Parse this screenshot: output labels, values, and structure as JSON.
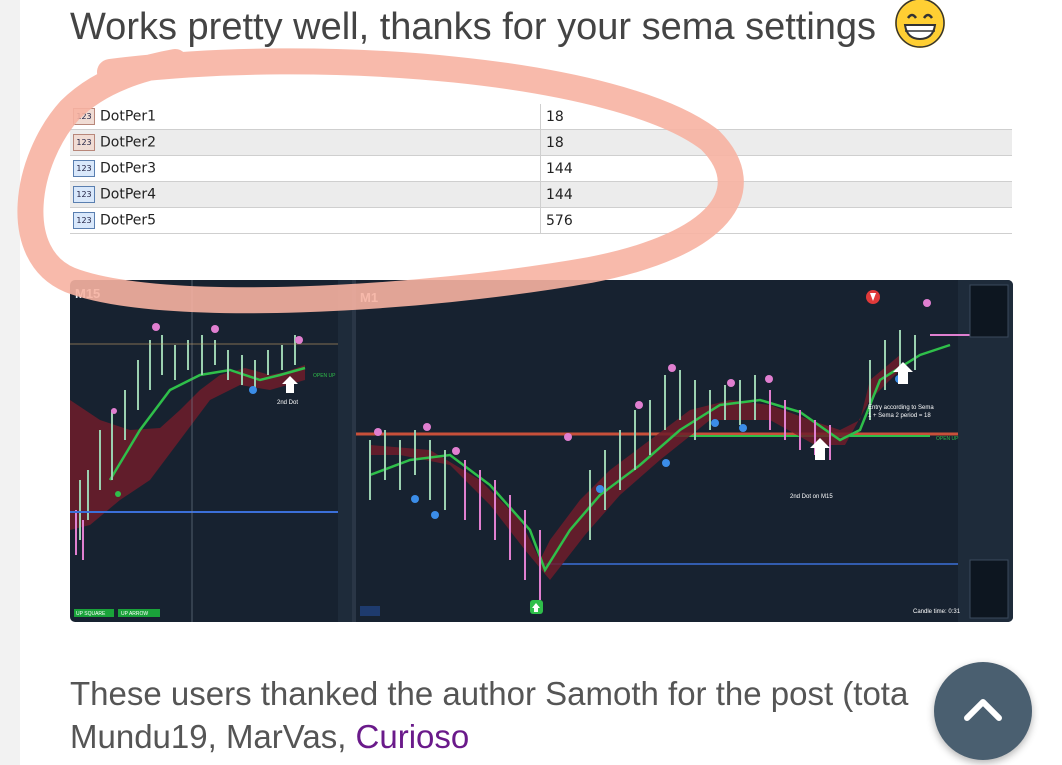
{
  "post": {
    "title": "Works pretty well, thanks for your sema settings",
    "emoji": "grinning-face"
  },
  "settings": {
    "type_badge": "123",
    "rows": [
      {
        "name": "DotPer1",
        "value": "18"
      },
      {
        "name": "DotPer2",
        "value": "18"
      },
      {
        "name": "DotPer3",
        "value": "144"
      },
      {
        "name": "DotPer4",
        "value": "144"
      },
      {
        "name": "DotPer5",
        "value": "576"
      }
    ]
  },
  "chart_screenshot": {
    "left_timeframe": "M15",
    "right_timeframe": "M1",
    "annotation_left": "2nd Dot",
    "annotation_mid": "2nd Dot on M15",
    "annotation_entry_1": "Entry according to Sema",
    "annotation_entry_2": "1 + Sema 2 period = 18",
    "button_up_square": "UP SQUARE",
    "button_up_arrow": "UP ARROW",
    "candle_time": "Candle time: 0:31",
    "open_up": "OPEN UP",
    "colors": {
      "background": "#172230",
      "bull": "#2fbf4a",
      "bear": "#a8223a",
      "dot_pink": "#e07fd0",
      "dot_blue": "#3b8de8"
    }
  },
  "thanks": {
    "line1": "These users thanked the author Samoth for the post (tota",
    "line2_users": "Mundu19, MarVas, ",
    "line2_link": "Curioso"
  },
  "scroll_top": {
    "icon": "chevron-up-icon"
  }
}
